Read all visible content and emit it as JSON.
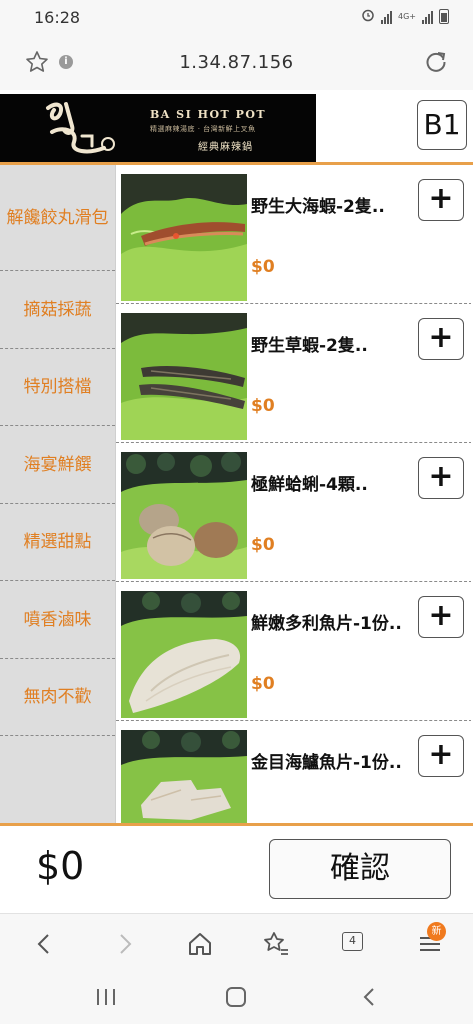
{
  "status_bar": {
    "time": "16:28",
    "network": "4G+"
  },
  "address_bar": {
    "url": "1.34.87.156"
  },
  "banner": {
    "brand_en": "BA SI HOT POT",
    "brand_sub": "精選麻辣湯底 · 台灣新鮮上叉魚",
    "brand_tag": "經典麻辣鍋",
    "table_label": "B1"
  },
  "categories": [
    {
      "label": "解饞餃丸滑包"
    },
    {
      "label": "摘菇採蔬"
    },
    {
      "label": "特別搭檔"
    },
    {
      "label": "海宴鮮饌"
    },
    {
      "label": "精選甜點"
    },
    {
      "label": "噴香滷味"
    },
    {
      "label": "無肉不歡"
    }
  ],
  "products": [
    {
      "name": "野生大海蝦-2隻..",
      "price": "$0",
      "add_label": "+",
      "image": "shrimp-large"
    },
    {
      "name": "野生草蝦-2隻..",
      "price": "$0",
      "add_label": "+",
      "image": "grass-shrimp"
    },
    {
      "name": "極鮮蛤蜊-4顆..",
      "price": "$0",
      "add_label": "+",
      "image": "clams"
    },
    {
      "name": "鮮嫩多利魚片-1份..",
      "price": "$0",
      "add_label": "+",
      "image": "dory-fillet"
    },
    {
      "name": "金目海鱸魚片-1份..",
      "price": "",
      "add_label": "+",
      "image": "sea-bass-fillet"
    }
  ],
  "order_bar": {
    "total": "$0",
    "confirm_label": "確認"
  },
  "browser_toolbar": {
    "tab_count": "4",
    "badge": "新"
  },
  "colors": {
    "accent": "#e07f22",
    "divider": "#e8a04a",
    "sidebar_bg": "#dddddd"
  }
}
